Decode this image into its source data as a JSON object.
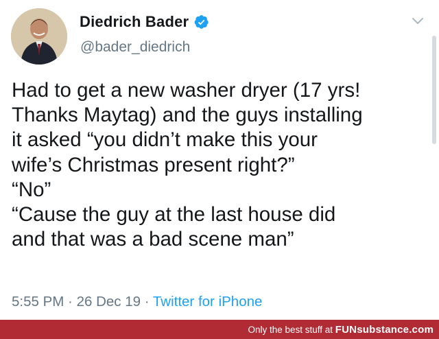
{
  "user": {
    "display_name": "Diedrich Bader",
    "handle": "@bader_diedrich",
    "verified": true,
    "avatar_icon": "profile-photo"
  },
  "tweet": {
    "lines": [
      "Had to get a new washer dryer (17 yrs!",
      "Thanks Maytag) and the guys installing",
      "it asked “you didn’t make this your",
      "wife’s Christmas present right?”",
      "“No”",
      "“Cause the guy at the last house did",
      "and that was a bad scene man”"
    ],
    "time": "5:55 PM",
    "separator": " · ",
    "date": "26 Dec 19",
    "source": "Twitter for iPhone"
  },
  "icons": {
    "verified": "verified-badge-icon",
    "menu": "chevron-down-icon"
  },
  "footer": {
    "tagline": "Only the best stuff at ",
    "brand": "FUNsubstance.com"
  },
  "colors": {
    "link": "#1da1f2",
    "muted": "#657786",
    "text": "#14171a",
    "footer_bg": "#b02b33"
  }
}
